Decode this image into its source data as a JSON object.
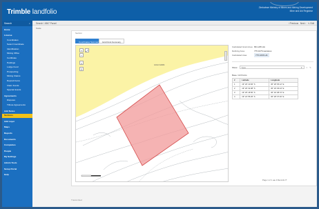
{
  "header": {
    "brand_main": "Trimble",
    "brand_sub": "landfolio",
    "org_line": "Zimbabwe Ministry of Mines and Mining Development",
    "user_line": "Mine and Aid Registrar"
  },
  "sidebar": {
    "search_label": "Search",
    "items": [
      {
        "label": "Home",
        "kind": "sec"
      },
      {
        "label": "License",
        "kind": "sec"
      },
      {
        "label": "Coordinates",
        "kind": "sub"
      },
      {
        "label": "Select Coordinate",
        "kind": "sub"
      },
      {
        "label": "Identification",
        "kind": "sub"
      },
      {
        "label": "Mining Office",
        "kind": "sub"
      },
      {
        "label": "Certificate",
        "kind": "sub"
      },
      {
        "label": "Holdings",
        "kind": "sub"
      },
      {
        "label": "Lodge Fund",
        "kind": "sub"
      },
      {
        "label": "Prospecting",
        "kind": "sub"
      },
      {
        "label": "Mining Claims",
        "kind": "sub"
      },
      {
        "label": "Deposit Items",
        "kind": "sub"
      },
      {
        "label": "Claim Funds",
        "kind": "sub"
      },
      {
        "label": "Special Grants",
        "kind": "sub"
      },
      {
        "label": "Agreements",
        "kind": "sec"
      },
      {
        "label": "Disputes",
        "kind": "sub"
      },
      {
        "label": "Tribute Agreements",
        "kind": "sub"
      },
      {
        "label": "Add Notes",
        "kind": "sec"
      },
      {
        "label": "Sections",
        "kind": "active"
      },
      {
        "label": "Add Layer",
        "kind": "sec"
      },
      {
        "label": "Maps",
        "kind": "sec"
      },
      {
        "label": "Reports",
        "kind": "sec"
      },
      {
        "label": "Documents",
        "kind": "sec"
      },
      {
        "label": "Companies",
        "kind": "sec"
      },
      {
        "label": "People",
        "kind": "sec"
      },
      {
        "label": "My Settings",
        "kind": "sec"
      },
      {
        "label": "Admin Tools",
        "kind": "sec"
      },
      {
        "label": "Setup Portal",
        "kind": "sec"
      },
      {
        "label": "Help",
        "kind": "sec"
      }
    ]
  },
  "breadcrumb": {
    "text": "Search / 4567 Parcel",
    "sub": "Scale",
    "previous": "‹ Previous",
    "next": "Next ›",
    "edit": "Edit"
  },
  "panel": {
    "title": "Section",
    "tabs": [
      "Coordinates Summary",
      "Grid Point Summary"
    ],
    "map_label": "GOLD FARM",
    "info": [
      {
        "key": "Calculated Grant Area",
        "value": "831.245 HA"
      },
      {
        "key": "Defining Area",
        "value": "775.1076 Hectares"
      },
      {
        "key": "Calculated Area",
        "value": "775.1096 HA",
        "pill": true
      }
    ],
    "show_label": "Show",
    "show_value": "Type",
    "coord_title": "Base / All Points",
    "table_headers": [
      "#",
      "Latitude",
      "Longitude"
    ],
    "rows": [
      [
        "1",
        "19° 26' 10.84\" S",
        "30° 28' 05.12\" E"
      ],
      [
        "2",
        "19° 26' 32.08\" S",
        "30° 29' 36.44\" E"
      ],
      [
        "3",
        "19° 25' 18.50\" S",
        "30° 30' 08.72\" E"
      ],
      [
        "4",
        "19° 24' 55.26\" S",
        "30° 28' 37.40\" E"
      ]
    ],
    "pager": "Page 1 of 1  ◂ ▸  4 Records  ⟳"
  },
  "footer": "Transmitted"
}
